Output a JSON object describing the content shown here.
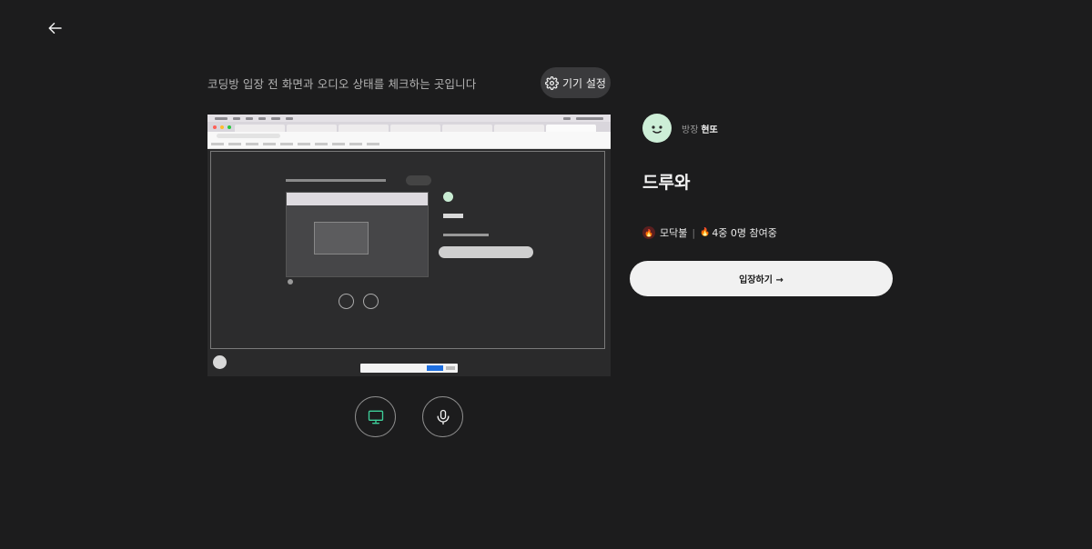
{
  "header": {
    "back_icon": "arrow-left-icon",
    "subtitle": "코딩방 입장 전 화면과 오디오 상태를 체크하는 곳입니다",
    "device_settings_label": "기기 설정",
    "device_settings_icon": "gear-icon"
  },
  "preview": {
    "description_icon": "screen-share-preview"
  },
  "controls": {
    "screen_icon": "monitor-icon",
    "mic_icon": "microphone-icon",
    "accent_color": "#3ecf9a"
  },
  "room": {
    "host_prefix": "방장",
    "host_name": "현또",
    "title": "드루와",
    "fire_label": "모닥불",
    "participants": "4중 0명 참여중",
    "enter_label": "입장하기 →"
  }
}
